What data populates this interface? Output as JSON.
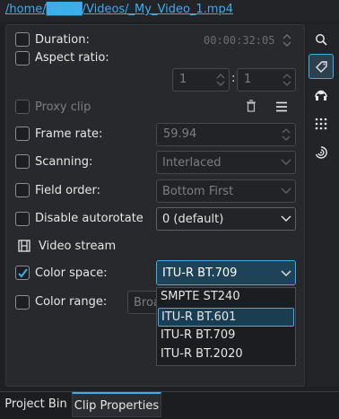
{
  "path_link": "/home/████/Videos/_My_Video_1.mp4",
  "duration": {
    "label": "Duration:",
    "value": "00:00:32:05"
  },
  "aspect_ratio": {
    "label": "Aspect ratio:",
    "num": "1",
    "separator": ":",
    "den": "1"
  },
  "proxy_clip": {
    "label": "Proxy clip"
  },
  "frame_rate": {
    "label": "Frame rate:",
    "value": "59.94"
  },
  "scanning": {
    "label": "Scanning:",
    "value": "Interlaced"
  },
  "field_order": {
    "label": "Field order:",
    "value": "Bottom First"
  },
  "disable_autorotate": {
    "label": "Disable autorotate",
    "value": "0 (default)"
  },
  "video_stream": {
    "label": "Video stream"
  },
  "color_space": {
    "label": "Color space:",
    "value": "ITU-R BT.709",
    "checked": true
  },
  "color_range": {
    "label": "Color range:",
    "value": "Broa"
  },
  "color_space_options": [
    "SMPTE ST240",
    "ITU-R BT.601",
    "ITU-R BT.709",
    "ITU-R BT.2020"
  ],
  "highlighted_option": "ITU-R BT.601",
  "sidebar_icons": [
    "search-icon",
    "tag-icon",
    "audio-icon",
    "grid-icon",
    "fingerprint-icon"
  ],
  "tabs": [
    "Project Bin",
    "Clip Properties"
  ],
  "active_tab": "Clip Properties",
  "accent_color": "#3daee9"
}
